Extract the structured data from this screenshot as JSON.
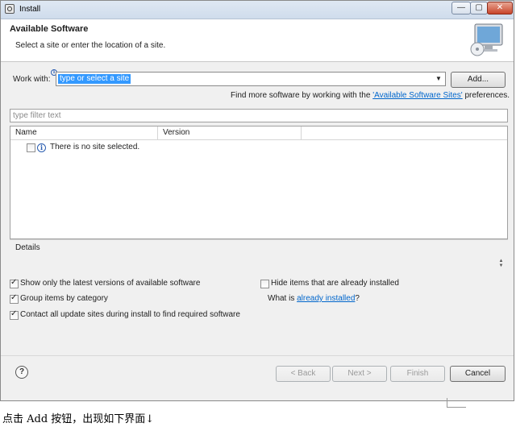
{
  "window": {
    "title": "Install",
    "min_glyph": "—",
    "max_glyph": "▢",
    "close_glyph": "✕"
  },
  "header": {
    "title": "Available Software",
    "subtitle": "Select a site or enter the location of a site."
  },
  "work_with": {
    "label": "Work with:",
    "value": "type or select a site",
    "add_button": "Add..."
  },
  "find_more": {
    "prefix": "Find more software by working with the ",
    "link": "'Available Software Sites'",
    "suffix": " preferences."
  },
  "filter": {
    "placeholder": "type filter text"
  },
  "table": {
    "columns": [
      "Name",
      "Version"
    ],
    "rows": [
      {
        "name": "There is no site selected.",
        "checked": false
      }
    ]
  },
  "details": {
    "label": "Details"
  },
  "options": {
    "show_latest": {
      "label": "Show only the latest versions of available software",
      "checked": true
    },
    "group_by_category": {
      "label": "Group items by category",
      "checked": true
    },
    "contact_sites": {
      "label": "Contact all update sites during install to find required software",
      "checked": true
    },
    "hide_installed": {
      "label": "Hide items that are already installed",
      "checked": false
    },
    "what_is": {
      "prefix": "What is ",
      "link": "already installed",
      "suffix": "?"
    }
  },
  "buttons": {
    "back": "< Back",
    "next": "Next >",
    "finish": "Finish",
    "cancel": "Cancel",
    "help": "?"
  },
  "caption": "点击 Add 按钮，出现如下界面↓",
  "colors": {
    "selection": "#3399ff",
    "link": "#0066cc"
  }
}
